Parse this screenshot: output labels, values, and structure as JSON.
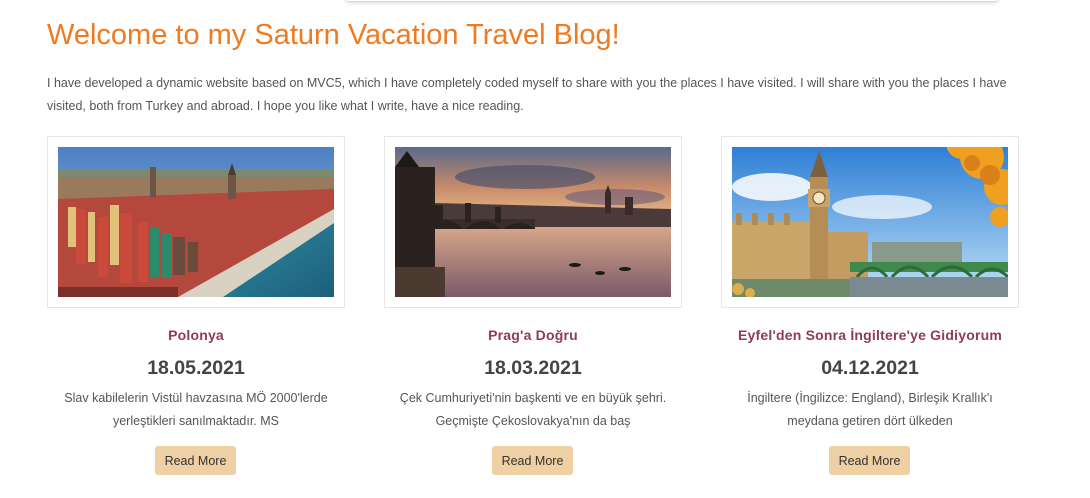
{
  "page": {
    "title": "Welcome to my Saturn Vacation Travel Blog!",
    "intro": "I have developed a dynamic website based on MVC5, which I have completely coded myself to share with you the places I have visited. I will share with you the places I have visited, both from Turkey and abroad. I hope you like what I write, have a nice reading."
  },
  "colors": {
    "title": "#f07a1f",
    "card_title": "#8e3a5a",
    "button_bg": "#efcfa4"
  },
  "posts": [
    {
      "title": "Polonya",
      "date": "18.05.2021",
      "excerpt_line1": "Slav kabilelerin Vistül havzasına MÖ 2000'lerde",
      "excerpt_line2": "yerleştikleri sanılmaktadır. MS",
      "button": "Read More"
    },
    {
      "title": "Prag'a Doğru",
      "date": "18.03.2021",
      "excerpt_line1": "Çek Cumhuriyeti'nin başkenti ve en büyük şehri.",
      "excerpt_line2": "Geçmişte Çekoslovakya'nın da baş",
      "button": "Read More"
    },
    {
      "title": "Eyfel'den Sonra İngiltere'ye Gidiyorum",
      "date": "04.12.2021",
      "excerpt_line1": "İngiltere (İngilizce: England), Birleşik Krallık'ı",
      "excerpt_line2": "meydana getiren dört ülkeden",
      "button": "Read More"
    }
  ]
}
